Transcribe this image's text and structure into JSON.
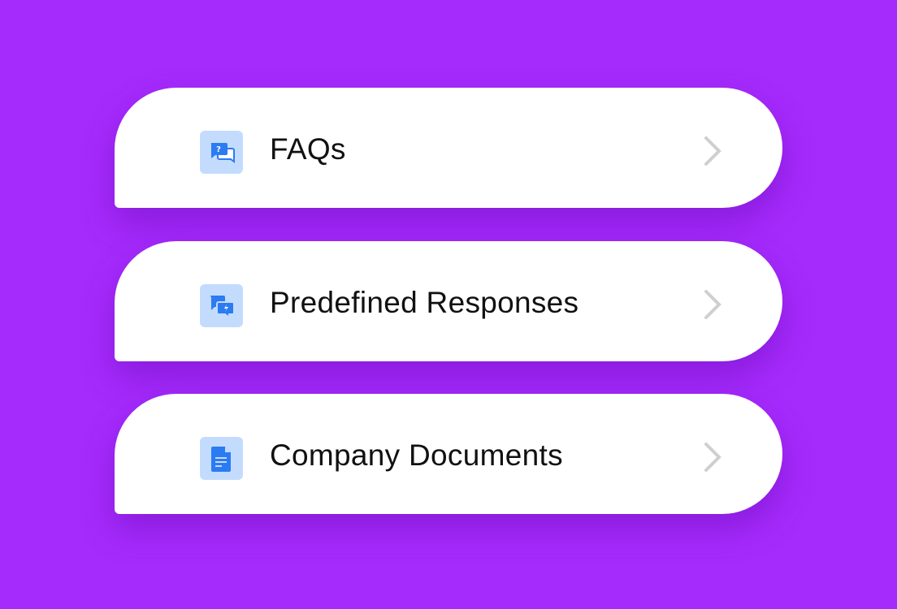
{
  "colors": {
    "background": "#a52afc",
    "card": "#ffffff",
    "icon_bg": "#c3dcfd",
    "icon_fg": "#2b7bf3",
    "chevron": "#cfcfcf"
  },
  "items": [
    {
      "label": "FAQs",
      "icon": "faq-chat-icon"
    },
    {
      "label": "Predefined Responses",
      "icon": "quick-response-chat-icon"
    },
    {
      "label": "Company Documents",
      "icon": "document-icon"
    }
  ]
}
